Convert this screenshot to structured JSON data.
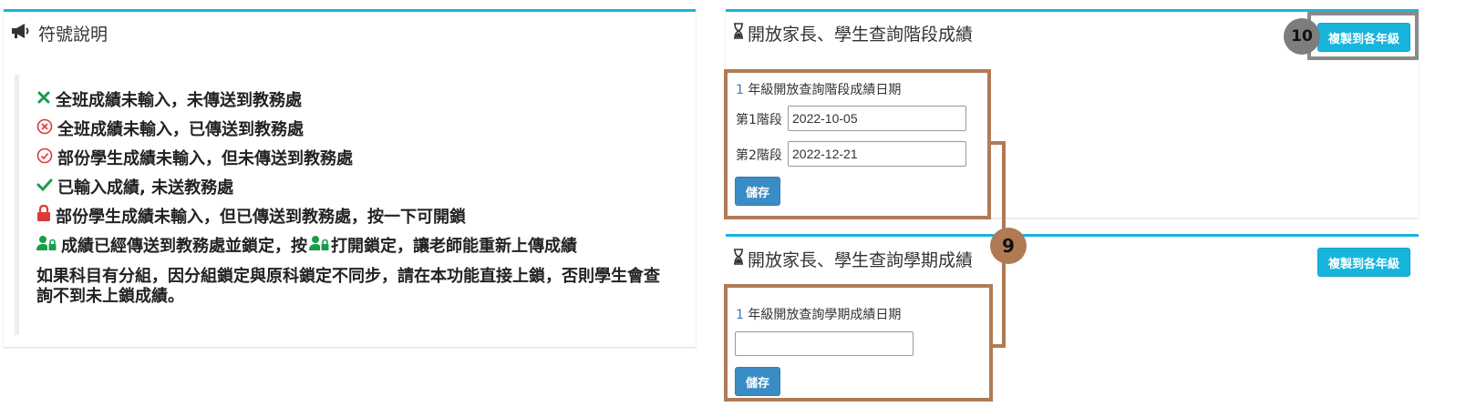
{
  "legend_panel": {
    "title": "符號說明",
    "items": [
      {
        "icon": "x-icon",
        "color": "#1a9c4b",
        "text": "全班成績未輸入，未傳送到教務處"
      },
      {
        "icon": "x-circle-icon",
        "color": "#e0383a",
        "text": "全班成績未輸入，已傳送到教務處"
      },
      {
        "icon": "check-circle-icon",
        "color": "#e0383a",
        "text": "部份學生成績未輸入，但未傳送到教務處"
      },
      {
        "icon": "check-icon",
        "color": "#1a9c4b",
        "text": "已輸入成績, 未送教務處"
      },
      {
        "icon": "lock-icon",
        "color": "#e0383a",
        "text": "部份學生成績未輸入，但已傳送到教務處，按一下可開鎖"
      }
    ],
    "lock_row": {
      "text_before": "成績已經傳送到教務處並鎖定，按",
      "text_after": "打開鎖定，讓老師能重新上傳成績"
    },
    "note": "如果科目有分組，因分組鎖定與原科鎖定不同步，請在本功能直接上鎖，否則學生會查詢不到未上鎖成績。"
  },
  "stage_panel": {
    "title": "開放家長、學生查詢階段成績",
    "copy_button": "複製到各年級",
    "grade_number": "1",
    "grade_label": "年級開放查詢階段成績日期",
    "stage1_label": "第1階段",
    "stage1_value": "2022-10-05",
    "stage2_label": "第2階段",
    "stage2_value": "2022-12-21",
    "save_button": "儲存"
  },
  "semester_panel": {
    "title": "開放家長、學生查詢學期成績",
    "copy_button": "複製到各年級",
    "grade_number": "1",
    "grade_label": "年級開放查詢學期成績日期",
    "date_value": "",
    "save_button": "儲存"
  },
  "annotations": {
    "marker_9": "9",
    "marker_10": "10"
  },
  "colors": {
    "accent": "#17b5dc",
    "save": "#3a8cc4",
    "annotation": "#b07a55"
  }
}
